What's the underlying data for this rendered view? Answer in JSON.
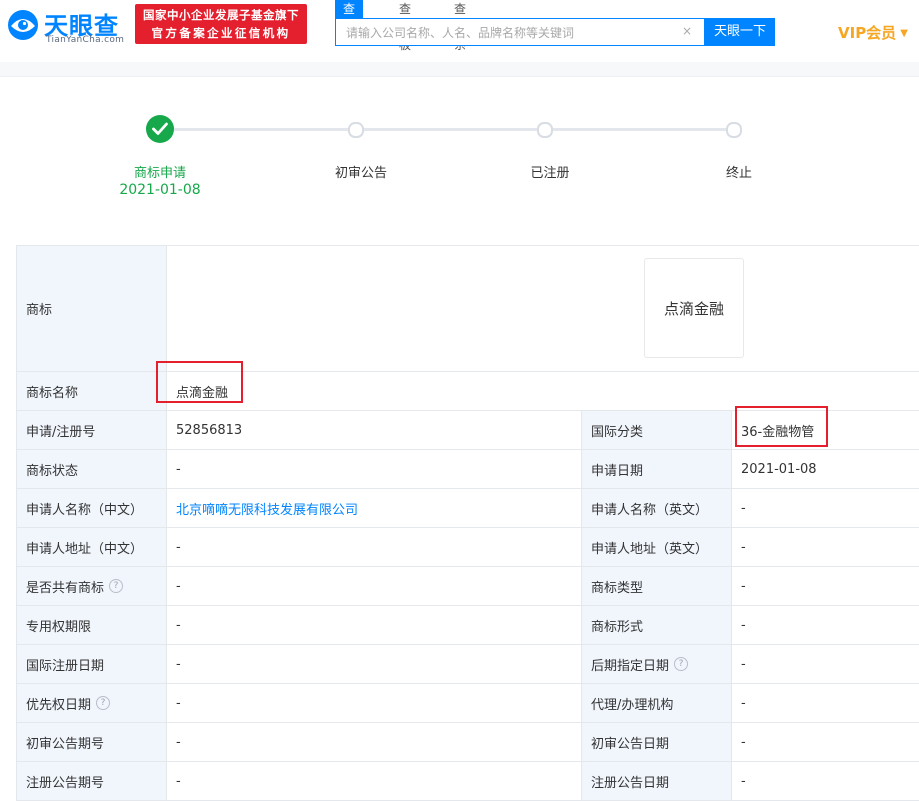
{
  "header": {
    "logo_cn": "天眼查",
    "logo_en": "TianYanCha.com",
    "badge_line1": "国家中小企业发展子基金旗下",
    "badge_line2": "官方备案企业征信机构",
    "tabs": [
      {
        "label": "查公司"
      },
      {
        "label": "查老板"
      },
      {
        "label": "查关系"
      }
    ],
    "search_placeholder": "请输入公司名称、人名、品牌名称等关键词",
    "search_button": "天眼一下",
    "vip_label": "VIP会员"
  },
  "progress": {
    "steps": [
      {
        "label": "商标申请",
        "date": "2021-01-08",
        "done": true
      },
      {
        "label": "初审公告"
      },
      {
        "label": "已注册"
      },
      {
        "label": "终止"
      }
    ]
  },
  "trademark": {
    "image_label": "商标",
    "image_text": "点滴金融",
    "name_label": "商标名称",
    "name_value": "点滴金融"
  },
  "rows": [
    {
      "l1": "申请/注册号",
      "v1": "52856813",
      "l2": "国际分类",
      "v2": "36-金融物管"
    },
    {
      "l1": "商标状态",
      "v1": "-",
      "l2": "申请日期",
      "v2": "2021-01-08"
    },
    {
      "l1": "申请人名称（中文）",
      "v1": "北京嘀嘀无限科技发展有限公司",
      "l2": "申请人名称（英文）",
      "v2": "-"
    },
    {
      "l1": "申请人地址（中文）",
      "v1": "-",
      "l2": "申请人地址（英文）",
      "v2": "-"
    },
    {
      "l1": "是否共有商标",
      "v1": "-",
      "l2": "商标类型",
      "v2": "-"
    },
    {
      "l1": "专用权期限",
      "v1": "-",
      "l2": "商标形式",
      "v2": "-"
    },
    {
      "l1": "国际注册日期",
      "v1": "-",
      "l2": "后期指定日期",
      "v2": "-"
    },
    {
      "l1": "优先权日期",
      "v1": "-",
      "l2": "代理/办理机构",
      "v2": "-"
    },
    {
      "l1": "初审公告期号",
      "v1": "-",
      "l2": "初审公告日期",
      "v2": "-"
    },
    {
      "l1": "注册公告期号",
      "v1": "-",
      "l2": "注册公告日期",
      "v2": "-"
    }
  ],
  "icons": {
    "help": "?",
    "clear": "×",
    "check": "check-icon",
    "caret": "▼"
  },
  "colors": {
    "brand": "#0084ff",
    "success": "#16a84a",
    "badge": "#e5202e",
    "vip": "#f5a623",
    "label_bg": "#f1f6fd"
  }
}
